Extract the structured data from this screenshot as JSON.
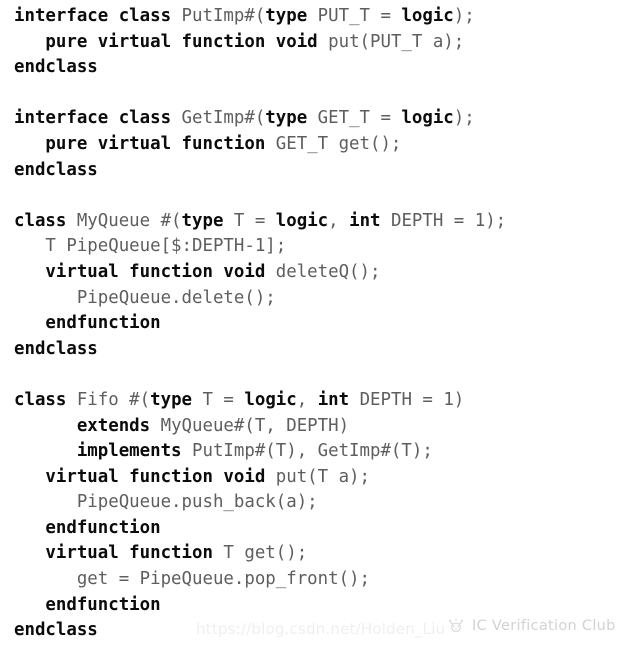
{
  "document": {
    "kind": "code-snippet",
    "language": "SystemVerilog",
    "colors": {
      "background": "#ffffff",
      "keyword": "#0b0b0b",
      "identifier": "#5e5e5e",
      "watermark_url": "#efefef",
      "watermark_brand": "#d2d2d2"
    }
  },
  "code": {
    "lines": [
      {
        "indent": 0,
        "tokens": [
          {
            "t": "kw",
            "s": "interface class "
          },
          {
            "t": "id",
            "s": "PutImp#("
          },
          {
            "t": "kw",
            "s": "type"
          },
          {
            "t": "id",
            "s": " PUT_T = "
          },
          {
            "t": "kw",
            "s": "logic"
          },
          {
            "t": "id",
            "s": ");"
          }
        ]
      },
      {
        "indent": 3,
        "tokens": [
          {
            "t": "kw",
            "s": "pure virtual function void "
          },
          {
            "t": "id",
            "s": "put(PUT_T a);"
          }
        ]
      },
      {
        "indent": 0,
        "tokens": [
          {
            "t": "kw",
            "s": "endclass"
          }
        ]
      },
      {
        "indent": 0,
        "tokens": []
      },
      {
        "indent": 0,
        "tokens": [
          {
            "t": "kw",
            "s": "interface class "
          },
          {
            "t": "id",
            "s": "GetImp#("
          },
          {
            "t": "kw",
            "s": "type"
          },
          {
            "t": "id",
            "s": " GET_T = "
          },
          {
            "t": "kw",
            "s": "logic"
          },
          {
            "t": "id",
            "s": ");"
          }
        ]
      },
      {
        "indent": 3,
        "tokens": [
          {
            "t": "kw",
            "s": "pure virtual function "
          },
          {
            "t": "id",
            "s": "GET_T get();"
          }
        ]
      },
      {
        "indent": 0,
        "tokens": [
          {
            "t": "kw",
            "s": "endclass"
          }
        ]
      },
      {
        "indent": 0,
        "tokens": []
      },
      {
        "indent": 0,
        "tokens": [
          {
            "t": "kw",
            "s": "class "
          },
          {
            "t": "id",
            "s": "MyQueue #("
          },
          {
            "t": "kw",
            "s": "type"
          },
          {
            "t": "id",
            "s": " T = "
          },
          {
            "t": "kw",
            "s": "logic"
          },
          {
            "t": "id",
            "s": ", "
          },
          {
            "t": "kw",
            "s": "int"
          },
          {
            "t": "id",
            "s": " DEPTH = 1);"
          }
        ]
      },
      {
        "indent": 3,
        "tokens": [
          {
            "t": "id",
            "s": "T PipeQueue[$:DEPTH-1];"
          }
        ]
      },
      {
        "indent": 3,
        "tokens": [
          {
            "t": "kw",
            "s": "virtual function void "
          },
          {
            "t": "id",
            "s": "deleteQ();"
          }
        ]
      },
      {
        "indent": 6,
        "tokens": [
          {
            "t": "id",
            "s": "PipeQueue.delete();"
          }
        ]
      },
      {
        "indent": 3,
        "tokens": [
          {
            "t": "kw",
            "s": "endfunction"
          }
        ]
      },
      {
        "indent": 0,
        "tokens": [
          {
            "t": "kw",
            "s": "endclass"
          }
        ]
      },
      {
        "indent": 0,
        "tokens": []
      },
      {
        "indent": 0,
        "tokens": [
          {
            "t": "kw",
            "s": "class "
          },
          {
            "t": "id",
            "s": "Fifo #("
          },
          {
            "t": "kw",
            "s": "type"
          },
          {
            "t": "id",
            "s": " T = "
          },
          {
            "t": "kw",
            "s": "logic"
          },
          {
            "t": "id",
            "s": ", "
          },
          {
            "t": "kw",
            "s": "int"
          },
          {
            "t": "id",
            "s": " DEPTH = 1)"
          }
        ]
      },
      {
        "indent": 6,
        "tokens": [
          {
            "t": "kw",
            "s": "extends "
          },
          {
            "t": "id",
            "s": "MyQueue#(T, DEPTH)"
          }
        ]
      },
      {
        "indent": 6,
        "tokens": [
          {
            "t": "kw",
            "s": "implements "
          },
          {
            "t": "id",
            "s": "PutImp#(T), GetImp#(T);"
          }
        ]
      },
      {
        "indent": 3,
        "tokens": [
          {
            "t": "kw",
            "s": "virtual function void "
          },
          {
            "t": "id",
            "s": "put(T a);"
          }
        ]
      },
      {
        "indent": 6,
        "tokens": [
          {
            "t": "id",
            "s": "PipeQueue.push_back(a);"
          }
        ]
      },
      {
        "indent": 3,
        "tokens": [
          {
            "t": "kw",
            "s": "endfunction"
          }
        ]
      },
      {
        "indent": 3,
        "tokens": [
          {
            "t": "kw",
            "s": "virtual function "
          },
          {
            "t": "id",
            "s": "T get();"
          }
        ]
      },
      {
        "indent": 6,
        "tokens": [
          {
            "t": "id",
            "s": "get = PipeQueue.pop_front();"
          }
        ]
      },
      {
        "indent": 3,
        "tokens": [
          {
            "t": "kw",
            "s": "endfunction"
          }
        ]
      },
      {
        "indent": 0,
        "tokens": [
          {
            "t": "kw",
            "s": "endclass"
          }
        ]
      }
    ]
  },
  "watermarks": {
    "url": "https://blog.csdn.net/Holden_Liu",
    "brand": "IC Verification Club",
    "brand_icon": "club-logo-icon"
  }
}
